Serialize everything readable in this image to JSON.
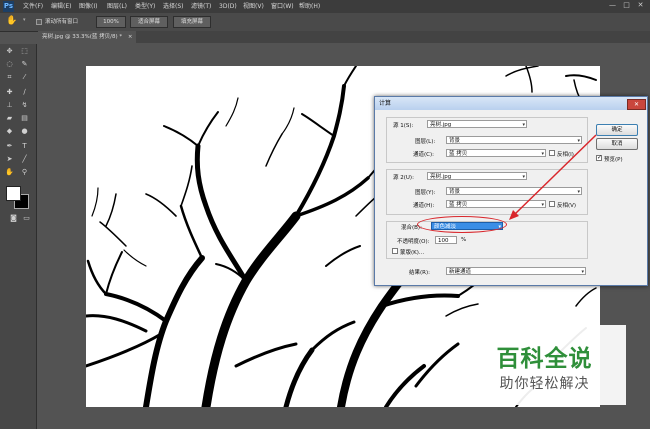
{
  "app": {
    "logo": "Ps"
  },
  "menu": [
    "文件(F)",
    "编辑(E)",
    "图像(I)",
    "图层(L)",
    "类型(Y)",
    "选择(S)",
    "滤镜(T)",
    "3D(D)",
    "视图(V)",
    "窗口(W)",
    "帮助(H)"
  ],
  "window_controls": {
    "minimize": "—",
    "restore": "□",
    "close": "✕"
  },
  "options": {
    "scroll_all_label": "滚动所有窗口",
    "zoom_100": "100%",
    "fit_screen": "适合屏幕",
    "fill_screen": "填充屏幕"
  },
  "document_tab": {
    "title": "亮树.jpg @ 33.3%(蓝 拷贝/8) *",
    "close": "×"
  },
  "dialog": {
    "title": "计算",
    "source1": {
      "label": "源 1(S):",
      "file": "亮树.jpg",
      "layer_label": "图层(L):",
      "layer": "背景",
      "channel_label": "通道(C):",
      "channel": "蓝 拷贝",
      "invert_label": "反相(I)"
    },
    "source2": {
      "label": "源 2(U):",
      "file": "亮树.jpg",
      "layer_label": "图层(Y):",
      "layer": "背景",
      "channel_label": "通道(H):",
      "channel": "蓝 拷贝",
      "invert_label": "反相(V)"
    },
    "blend": {
      "label": "混合(B):",
      "value": "颜色减淡",
      "opacity_label": "不透明度(O):",
      "opacity": "100",
      "opacity_unit": "%",
      "mask_label": "蒙版(K)..."
    },
    "result": {
      "label": "结果(R):",
      "value": "新建通道"
    },
    "buttons": {
      "ok": "确定",
      "cancel": "取消",
      "preview": "预览(P)"
    }
  },
  "watermark": {
    "title": "百科全说",
    "subtitle": "助你轻松解决"
  },
  "colors": {
    "accent_red": "#d9262b",
    "blend_highlight": "#3a8ee6",
    "watermark_green": "#2f8f3a"
  }
}
